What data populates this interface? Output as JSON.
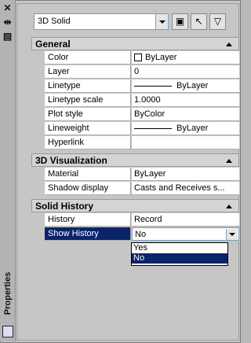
{
  "topbar": {
    "object_type": "3D Solid"
  },
  "icons": {
    "close": "close-icon",
    "autohide": "autohide-icon",
    "properties_menu": "properties-menu-icon"
  },
  "palette_title": "Properties",
  "sections": {
    "general": {
      "label": "General",
      "rows": [
        {
          "name": "Color",
          "value": "ByLayer"
        },
        {
          "name": "Layer",
          "value": "0"
        },
        {
          "name": "Linetype",
          "value": "ByLayer"
        },
        {
          "name": "Linetype scale",
          "value": "1.0000"
        },
        {
          "name": "Plot style",
          "value": "ByColor"
        },
        {
          "name": "Lineweight",
          "value": "ByLayer"
        },
        {
          "name": "Hyperlink",
          "value": ""
        }
      ]
    },
    "visualization": {
      "label": "3D Visualization",
      "rows": [
        {
          "name": "Material",
          "value": "ByLayer"
        },
        {
          "name": "Shadow display",
          "value": "Casts and Receives s..."
        }
      ]
    },
    "history": {
      "label": "Solid History",
      "rows": [
        {
          "name": "History",
          "value": "Record"
        },
        {
          "name": "Show History",
          "value": "No"
        }
      ]
    }
  },
  "dropdown_options": [
    "Yes",
    "No"
  ],
  "dropdown_highlighted": "No"
}
